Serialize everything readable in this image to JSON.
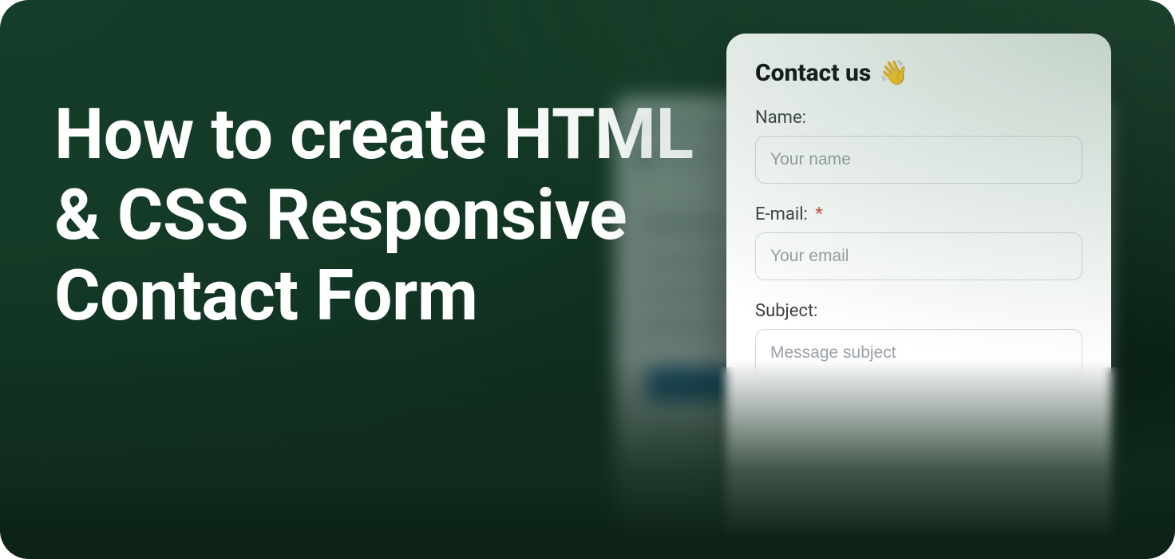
{
  "headline": "How to create HTML & CSS Responsive Contact Form",
  "form": {
    "title": "Contact us",
    "emoji": "👋",
    "fields": {
      "name": {
        "label": "Name:",
        "placeholder": "Your name",
        "required": false
      },
      "email": {
        "label": "E-mail:",
        "placeholder": "Your email",
        "required": true,
        "required_mark": "*"
      },
      "subject": {
        "label": "Subject:",
        "placeholder": "Message subject",
        "required": false
      }
    }
  }
}
